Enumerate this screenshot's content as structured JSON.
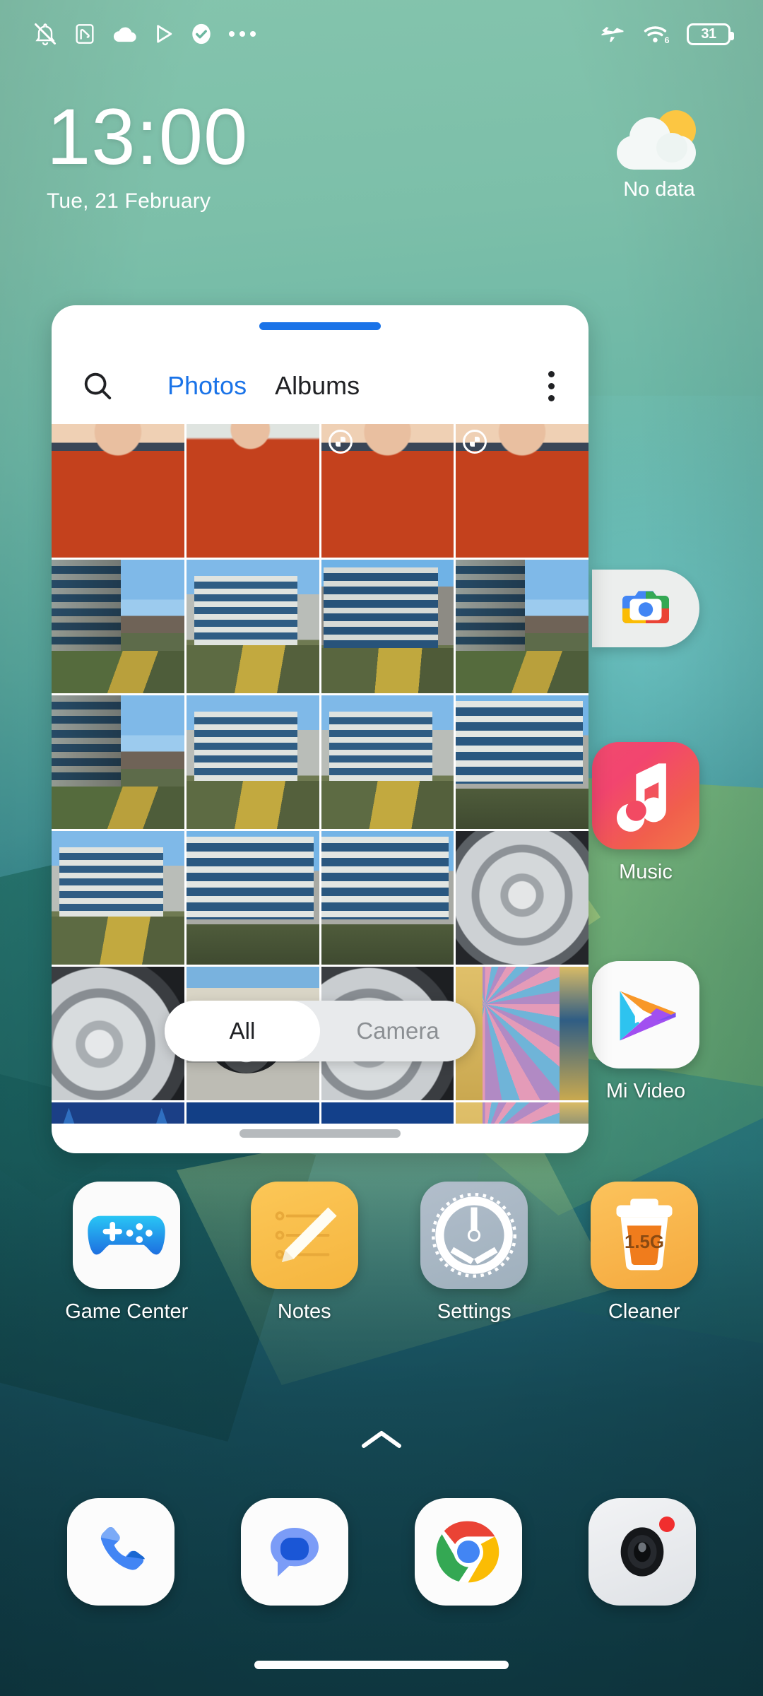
{
  "status_bar": {
    "left_icons": [
      "silent-bell-icon",
      "nfc-icon",
      "cloud-icon",
      "play-triangle-icon",
      "check-circle-icon",
      "more-dots-icon"
    ],
    "right_icons": [
      "airplane-mode-icon",
      "wifi-6-icon"
    ],
    "wifi_generation": "6",
    "battery_level": "31"
  },
  "clock": {
    "time": "13:00",
    "date": "Tue, 21 February"
  },
  "weather": {
    "condition": "No data",
    "icon": "sun-behind-cloud-icon"
  },
  "gallery_widget": {
    "search_icon": "search-icon",
    "overflow_icon": "overflow-menu-icon",
    "tabs": [
      {
        "label": "Photos",
        "active": true
      },
      {
        "label": "Albums",
        "active": false
      }
    ],
    "filter": [
      {
        "label": "All",
        "active": true
      },
      {
        "label": "Camera",
        "active": false
      }
    ],
    "grid": {
      "columns": 4,
      "cells": [
        {
          "kind": "p-person",
          "badge": false
        },
        {
          "kind": "p-person2",
          "badge": false
        },
        {
          "kind": "p-person",
          "badge": true
        },
        {
          "kind": "p-person",
          "badge": true
        },
        {
          "kind": "p-bldgA",
          "badge": false
        },
        {
          "kind": "p-bldgB",
          "badge": false
        },
        {
          "kind": "p-bldgC",
          "badge": false
        },
        {
          "kind": "p-bldgA",
          "badge": false
        },
        {
          "kind": "p-bldgA",
          "badge": false
        },
        {
          "kind": "p-bldgB",
          "badge": false
        },
        {
          "kind": "p-bldgB",
          "badge": false
        },
        {
          "kind": "p-bldgD",
          "badge": false
        },
        {
          "kind": "p-bldgB",
          "badge": false
        },
        {
          "kind": "p-bldgD",
          "badge": false
        },
        {
          "kind": "p-bldgD",
          "badge": false
        },
        {
          "kind": "p-wheel",
          "badge": false
        },
        {
          "kind": "p-wheel2",
          "badge": false
        },
        {
          "kind": "p-car",
          "badge": false
        },
        {
          "kind": "p-wheel2",
          "badge": false
        },
        {
          "kind": "p-mural",
          "badge": false
        },
        {
          "kind": "p-castle",
          "badge": false
        },
        {
          "kind": "p-blue",
          "badge": false
        },
        {
          "kind": "p-lot",
          "badge": false
        },
        {
          "kind": "p-mural",
          "badge": false
        }
      ]
    }
  },
  "side_apps": [
    {
      "name": "photos",
      "label": "",
      "icon": "google-photos-icon"
    },
    {
      "name": "music",
      "label": "Music",
      "icon": "music-note-icon"
    },
    {
      "name": "mi-video",
      "label": "Mi Video",
      "icon": "play-triangle-icon"
    }
  ],
  "app_row": [
    {
      "name": "game-center",
      "label": "Game Center",
      "icon": "gamepad-icon"
    },
    {
      "name": "notes",
      "label": "Notes",
      "icon": "pencil-notes-icon"
    },
    {
      "name": "settings",
      "label": "Settings",
      "icon": "gear-icon"
    },
    {
      "name": "cleaner",
      "label": "Cleaner",
      "icon": "trash-bin-icon",
      "badge_text": "1.5G"
    }
  ],
  "dock": [
    {
      "name": "phone",
      "icon": "phone-handset-icon"
    },
    {
      "name": "messages",
      "icon": "speech-bubble-icon"
    },
    {
      "name": "chrome",
      "icon": "chrome-icon"
    },
    {
      "name": "camera",
      "icon": "camera-lens-icon",
      "has_badge": true
    }
  ],
  "drawer_indicator": "chevron-up-icon",
  "colors": {
    "accent_blue": "#1a73e8",
    "widget_bg": "#ffffff",
    "text_light": "#ffffff"
  }
}
